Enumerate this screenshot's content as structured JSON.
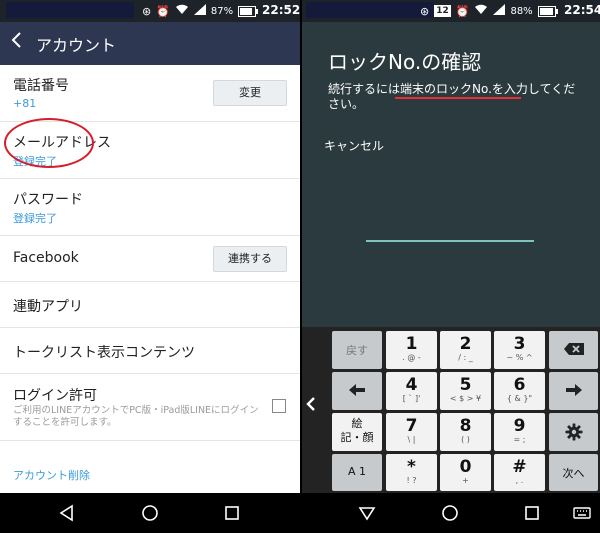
{
  "left": {
    "status": {
      "battery": "87%",
      "time": "22:52"
    },
    "header": {
      "title": "アカウント"
    },
    "rows": {
      "phone": {
        "label": "電話番号",
        "value": "+81",
        "button": "変更"
      },
      "email": {
        "label": "メールアドレス",
        "status": "登録完了"
      },
      "password": {
        "label": "パスワード",
        "status": "登録完了"
      },
      "facebook": {
        "label": "Facebook",
        "button": "連携する"
      },
      "apps": {
        "label": "連動アプリ"
      },
      "talklist": {
        "label": "トークリスト表示コンテンツ"
      },
      "login": {
        "label": "ログイン許可",
        "desc": "ご利用のLINEアカウントでPC版・iPad版LINEにログインすることを許可します。"
      },
      "delete": {
        "label": "アカウント削除"
      }
    }
  },
  "right": {
    "status": {
      "badge": "12",
      "battery": "88%",
      "time": "22:54"
    },
    "dialog": {
      "title": "ロックNo.の確認",
      "message": "続行するには端末のロックNo.を入力してください。",
      "cancel": "キャンセル"
    },
    "keyboard": {
      "modify": "戻す",
      "kuten": "絵\n記・顔",
      "mode": "A 1",
      "next": "次へ",
      "keys": [
        {
          "main": "1",
          "sub": ". @ -"
        },
        {
          "main": "2",
          "sub": "/ : _"
        },
        {
          "main": "3",
          "sub": "~ % ^"
        },
        {
          "main": "4",
          "sub": "[ ` ]'"
        },
        {
          "main": "5",
          "sub": "< $ > ¥"
        },
        {
          "main": "6",
          "sub": "{ & }\""
        },
        {
          "main": "7",
          "sub": "\\ |"
        },
        {
          "main": "8",
          "sub": "( )"
        },
        {
          "main": "9",
          "sub": "= ;"
        },
        {
          "main": "*",
          "sub": "! ?"
        },
        {
          "main": "0",
          "sub": "+"
        },
        {
          "main": "#",
          "sub": ", ."
        }
      ]
    }
  },
  "colors": {
    "header": "#2e3751",
    "link": "#3a9ad9",
    "dialog_bg": "#2b3a3e",
    "accent_line": "#7fc3bf",
    "annotation_red": "#d61e2b"
  }
}
